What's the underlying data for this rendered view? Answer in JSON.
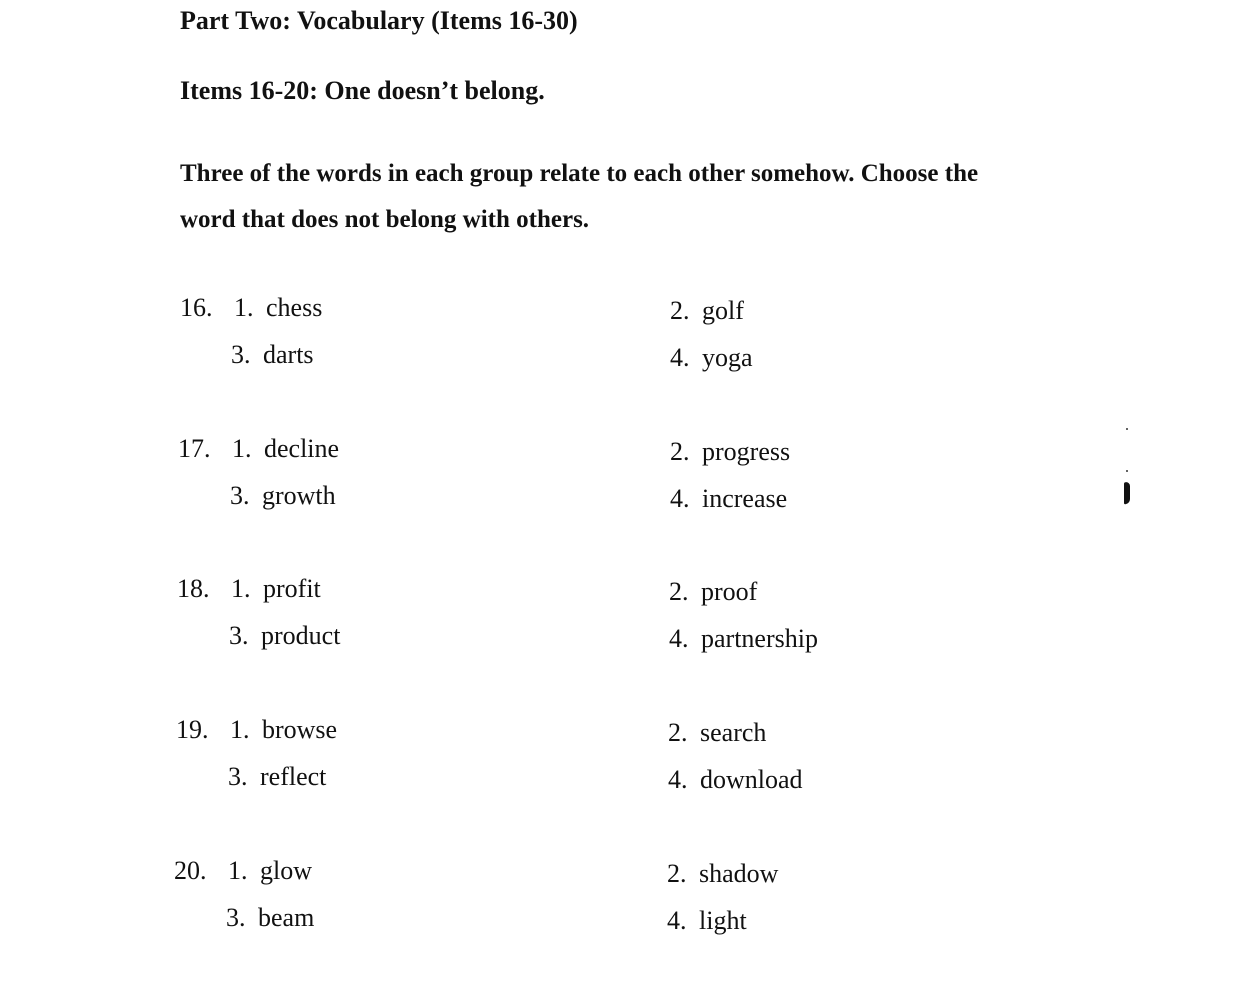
{
  "header": {
    "part_title": "Part Two:  Vocabulary  (Items 16-30)",
    "section_title": "Items 16-20:  One doesn’t belong."
  },
  "instructions": {
    "line1": "Three of the words in each group relate to each other somehow.  Choose the",
    "line2": "word that does not belong with others."
  },
  "questions": [
    {
      "number": "16.",
      "options": [
        {
          "num": "1.",
          "word": "chess"
        },
        {
          "num": "2.",
          "word": "golf"
        },
        {
          "num": "3.",
          "word": "darts"
        },
        {
          "num": "4.",
          "word": "yoga"
        }
      ]
    },
    {
      "number": "17.",
      "options": [
        {
          "num": "1.",
          "word": "decline"
        },
        {
          "num": "2.",
          "word": "progress"
        },
        {
          "num": "3.",
          "word": "growth"
        },
        {
          "num": "4.",
          "word": "increase"
        }
      ]
    },
    {
      "number": "18.",
      "options": [
        {
          "num": "1.",
          "word": "profit"
        },
        {
          "num": "2.",
          "word": "proof"
        },
        {
          "num": "3.",
          "word": "product"
        },
        {
          "num": "4.",
          "word": "partnership"
        }
      ]
    },
    {
      "number": "19.",
      "options": [
        {
          "num": "1.",
          "word": "browse"
        },
        {
          "num": "2.",
          "word": "search"
        },
        {
          "num": "3.",
          "word": "reflect"
        },
        {
          "num": "4.",
          "word": "download"
        }
      ]
    },
    {
      "number": "20.",
      "options": [
        {
          "num": "1.",
          "word": "glow"
        },
        {
          "num": "2.",
          "word": "shadow"
        },
        {
          "num": "3.",
          "word": "beam"
        },
        {
          "num": "4.",
          "word": "light"
        }
      ]
    }
  ]
}
